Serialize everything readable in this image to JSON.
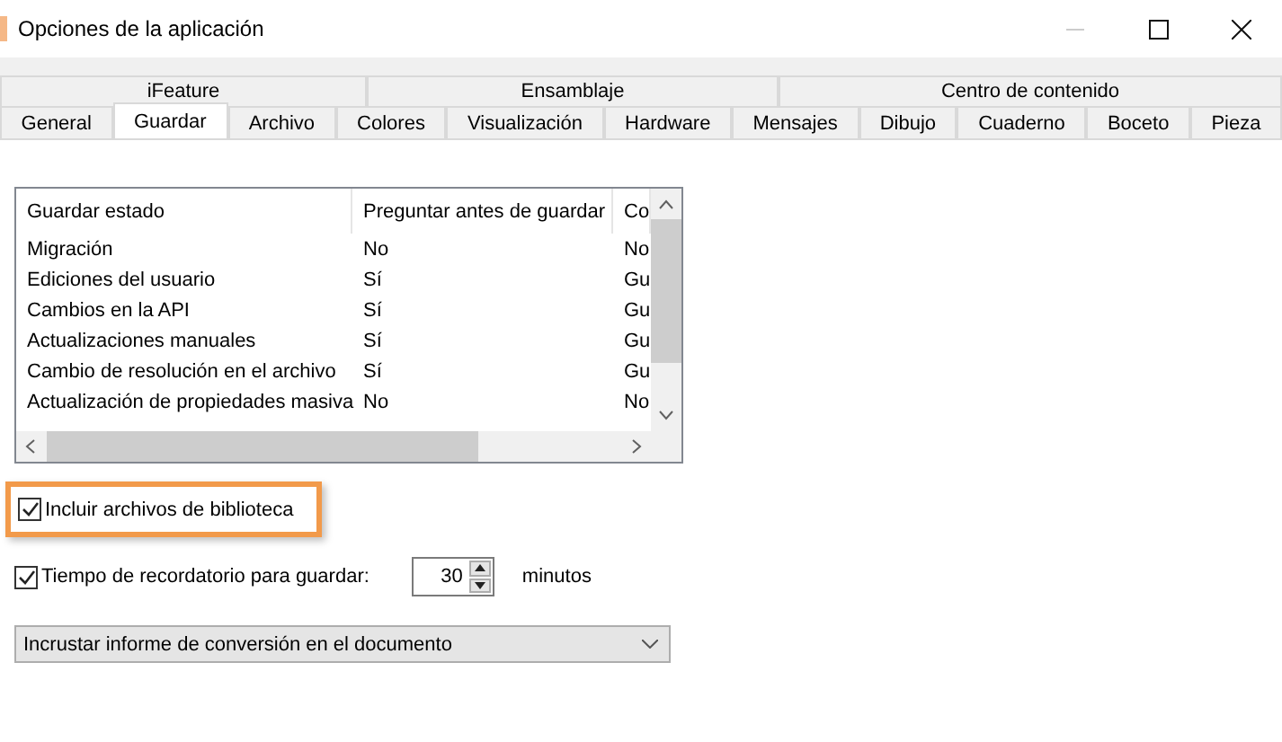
{
  "window": {
    "title": "Opciones de la aplicación"
  },
  "tab_groups": [
    {
      "label": "iFeature"
    },
    {
      "label": "Ensamblaje"
    },
    {
      "label": "Centro de contenido"
    }
  ],
  "tabs": [
    {
      "label": "General",
      "selected": false
    },
    {
      "label": "Guardar",
      "selected": true
    },
    {
      "label": "Archivo",
      "selected": false
    },
    {
      "label": "Colores",
      "selected": false
    },
    {
      "label": "Visualización",
      "selected": false
    },
    {
      "label": "Hardware",
      "selected": false
    },
    {
      "label": "Mensajes",
      "selected": false
    },
    {
      "label": "Dibujo",
      "selected": false
    },
    {
      "label": "Cuaderno",
      "selected": false
    },
    {
      "label": "Boceto",
      "selected": false
    },
    {
      "label": "Pieza",
      "selected": false
    }
  ],
  "table": {
    "columns": [
      "Guardar estado",
      "Preguntar antes de guardar",
      "Co"
    ],
    "rows": [
      [
        "Migración",
        "No",
        "No"
      ],
      [
        "Ediciones del usuario",
        "Sí",
        "Gu"
      ],
      [
        "Cambios en la API",
        "Sí",
        "Gu"
      ],
      [
        "Actualizaciones manuales",
        "Sí",
        "Gu"
      ],
      [
        "Cambio de resolución en el archivo",
        "Sí",
        "Gu"
      ],
      [
        "Actualización de propiedades masiva",
        "No",
        "No"
      ]
    ]
  },
  "include_library": {
    "label": "Incluir archivos de biblioteca",
    "checked": true,
    "highlighted": true
  },
  "reminder": {
    "label": "Tiempo de recordatorio para guardar:",
    "checked": true,
    "value": "30",
    "unit": "minutos"
  },
  "dropdown": {
    "value": "Incrustar informe de conversión en el documento"
  }
}
